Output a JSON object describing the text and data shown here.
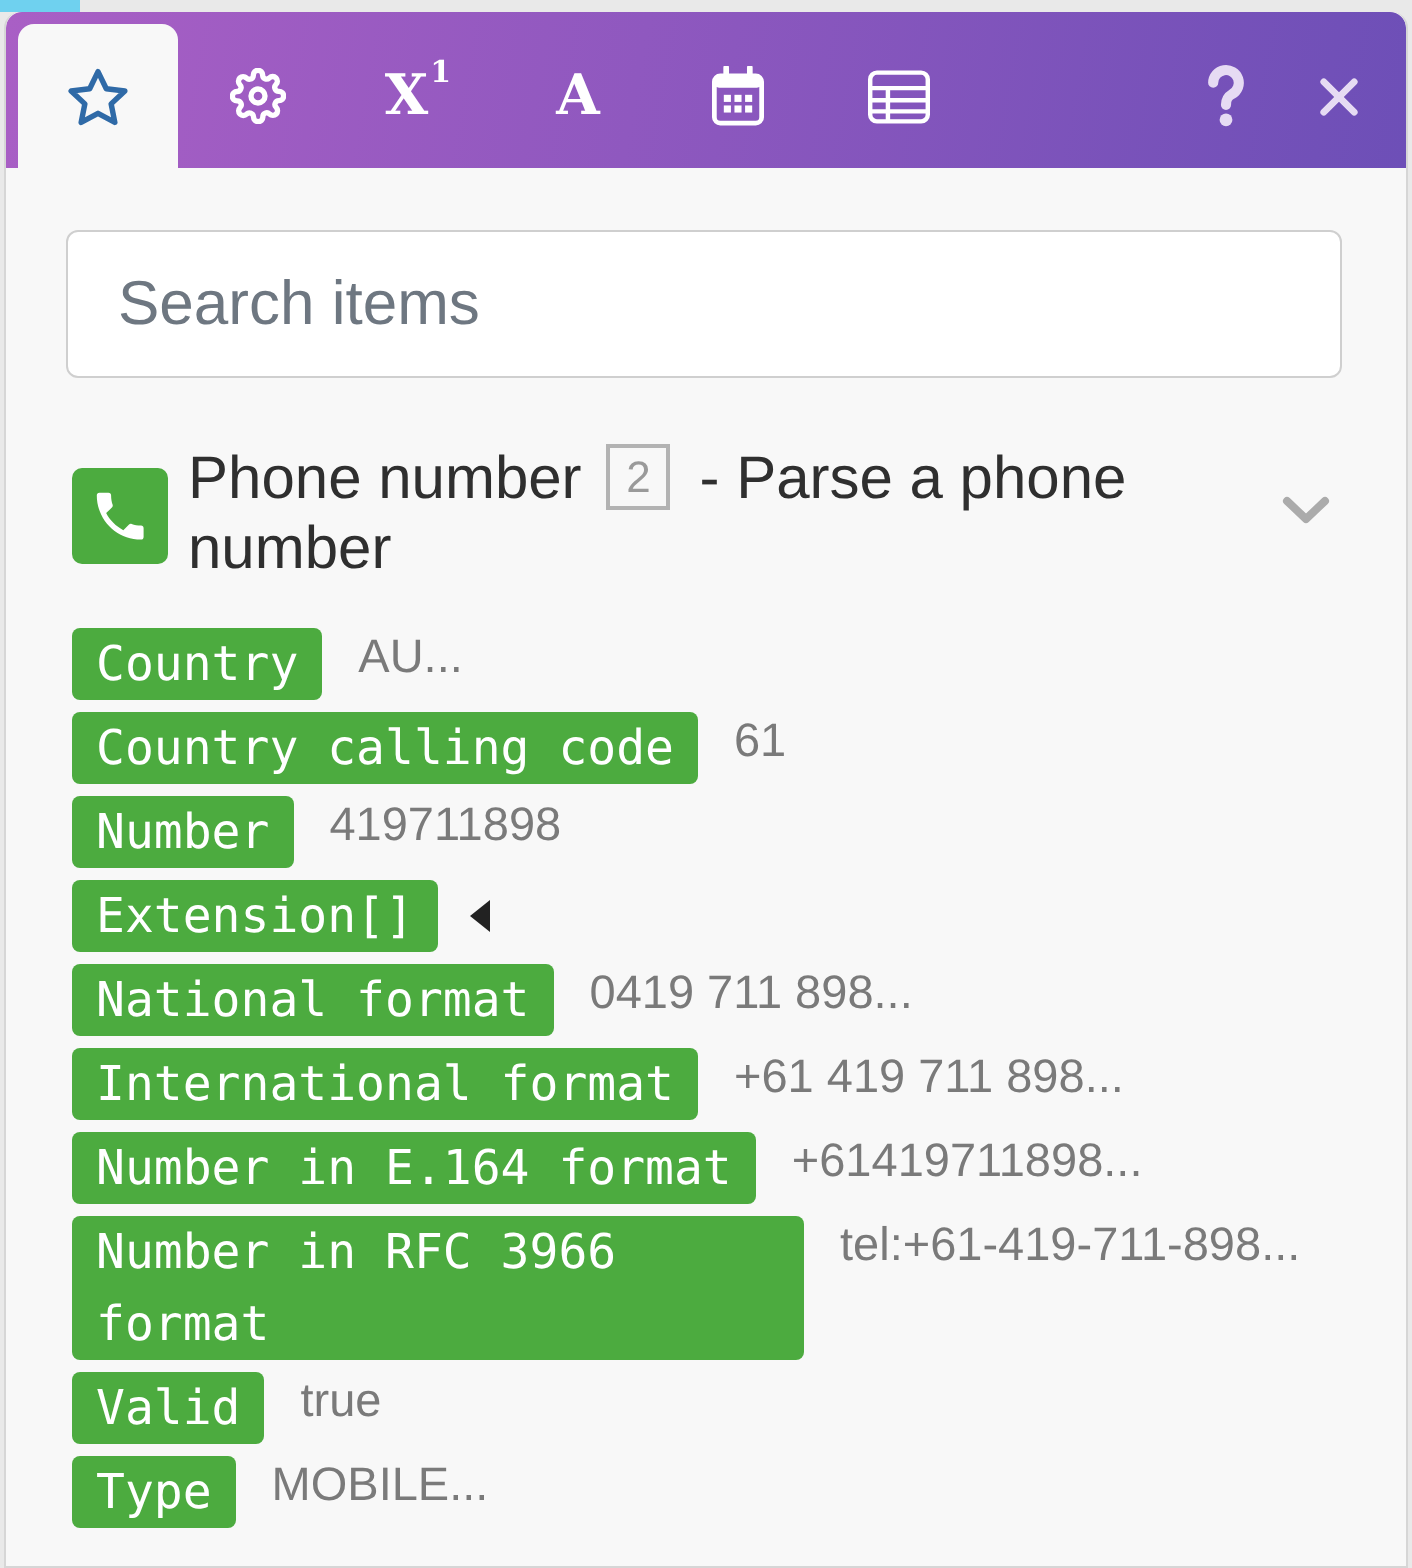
{
  "tabs": [
    {
      "kind": "favorites",
      "selected": true
    },
    {
      "kind": "settings",
      "selected": false
    },
    {
      "kind": "math",
      "label": "X$^{1}$",
      "selected": false
    },
    {
      "kind": "text",
      "label": "A",
      "selected": false
    },
    {
      "kind": "date",
      "selected": false
    },
    {
      "kind": "array",
      "selected": false
    }
  ],
  "search": {
    "placeholder": "Search items"
  },
  "module": {
    "name": "Phone number",
    "number": "2",
    "action": "- Parse a phone number",
    "expanded": true,
    "fields": [
      {
        "kind": "value",
        "label": "Country",
        "value": "AU..."
      },
      {
        "kind": "value",
        "label": "Country calling code",
        "value": "61"
      },
      {
        "kind": "value",
        "label": "Number",
        "value": "419711898"
      },
      {
        "kind": "collection",
        "label": "Extension[]",
        "expanded": false
      },
      {
        "kind": "value",
        "label": "National format",
        "value": "0419 711 898..."
      },
      {
        "kind": "value",
        "label": "International format",
        "value": "+61 419 711 898..."
      },
      {
        "kind": "value",
        "label": "Number in E.164 format",
        "value": "+61419711898..."
      },
      {
        "kind": "value",
        "label": "Number in RFC 3966 format",
        "value": "tel:+61-419-711-898..."
      },
      {
        "kind": "value",
        "label": "Valid",
        "value": "true"
      },
      {
        "kind": "value",
        "label": "Type",
        "value": "MOBILE..."
      }
    ]
  }
}
